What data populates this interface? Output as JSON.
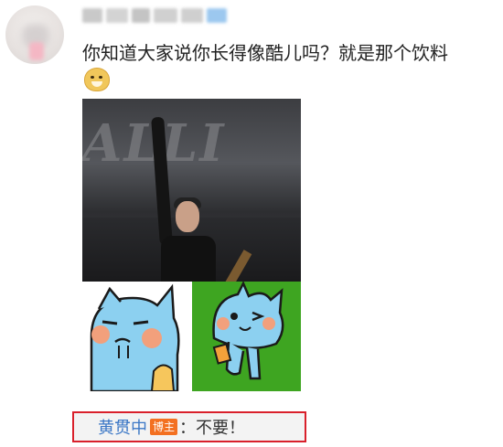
{
  "post": {
    "text": "你知道大家说你长得像酷儿吗？就是那个饮料",
    "emoji": "doge-emoji",
    "photo_sign_text": "ALLI"
  },
  "comment": {
    "author": "黄贯中",
    "badge": "博主",
    "text": "：不要！"
  },
  "colors": {
    "author_link": "#3b77c6",
    "badge_bg": "#f37021",
    "highlight_border": "#d9202b",
    "cat_bg_green": "#3ea521",
    "cat_blue": "#8cd0f0"
  }
}
